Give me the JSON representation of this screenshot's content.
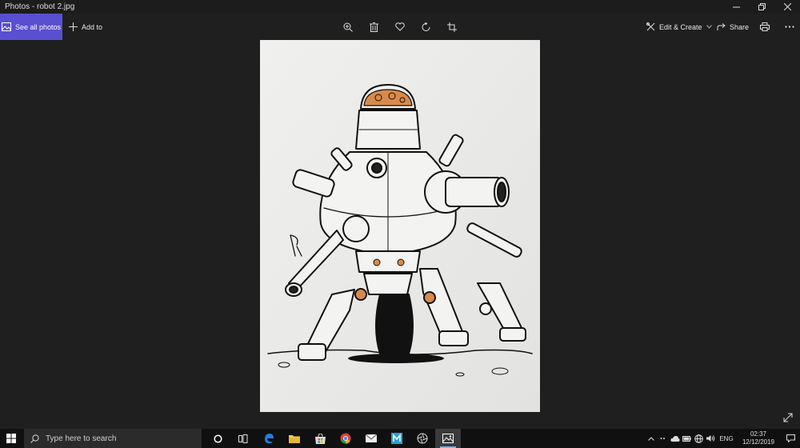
{
  "window": {
    "title": "Photos - robot 2.jpg"
  },
  "toolbar": {
    "see_all_label": "See all photos",
    "add_to_label": "Add to",
    "edit_create_label": "Edit & Create",
    "share_label": "Share",
    "accent_color": "#5a4fd0"
  },
  "photo": {
    "file_name": "robot 2.jpg"
  },
  "taskbar": {
    "search_placeholder": "Type here to search",
    "language": "ENG",
    "time": "02:37",
    "date": "12/12/2019",
    "apps": [
      "cortana",
      "task-view",
      "edge",
      "file-explorer",
      "store",
      "chrome",
      "mail",
      "media",
      "browser",
      "photos"
    ]
  }
}
